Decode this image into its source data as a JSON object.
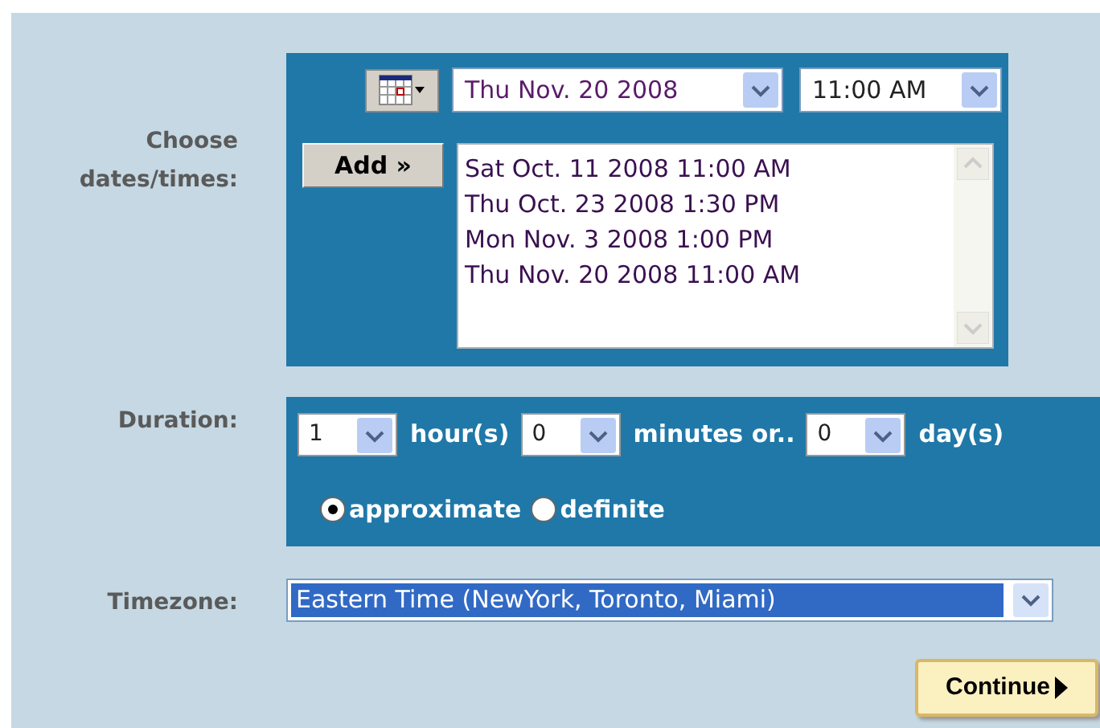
{
  "dates": {
    "label": "Choose dates/times:",
    "date_value": "Thu Nov. 20 2008",
    "time_value": "11:00 AM",
    "add_button": "Add »",
    "list": [
      "Sat Oct. 11 2008 11:00 AM",
      "Thu Oct. 23 2008 1:30 PM",
      "Mon Nov. 3 2008 1:00 PM",
      "Thu Nov. 20 2008 11:00 AM"
    ]
  },
  "duration": {
    "label": "Duration:",
    "fields": [
      {
        "value": "1",
        "unit": "hour(s)"
      },
      {
        "value": "0",
        "unit": "minutes or.."
      },
      {
        "value": "0",
        "unit": "day(s)"
      }
    ],
    "modes": [
      {
        "label": "approximate",
        "selected": true
      },
      {
        "label": "definite",
        "selected": false
      }
    ]
  },
  "timezone": {
    "label": "Timezone:",
    "value": "Eastern Time (NewYork, Toronto, Miami)"
  },
  "continue_button": "Continue"
}
